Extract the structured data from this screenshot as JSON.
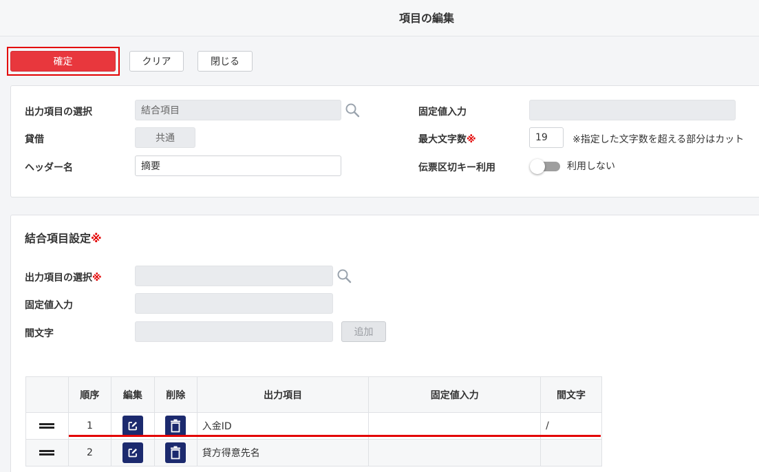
{
  "header": {
    "title": "項目の編集"
  },
  "toolbar": {
    "confirm_label": "確定",
    "clear_label": "クリア",
    "close_label": "閉じる"
  },
  "form": {
    "output_item_label": "出力項目の選択",
    "output_item_value": "結合項目",
    "debit_credit_label": "貸借",
    "debit_credit_value": "共通",
    "header_name_label": "ヘッダー名",
    "header_name_value": "摘要",
    "fixed_value_label": "固定値入力",
    "fixed_value_value": "",
    "max_chars_label": "最大文字数",
    "max_chars_required": "※",
    "max_chars_value": "19",
    "max_chars_note": "※指定した文字数を超える部分はカット",
    "voucher_split_label": "伝票区切キー利用",
    "voucher_split_toggle_label": "利用しない",
    "voucher_split_enabled": false
  },
  "combine": {
    "section_title": "結合項目設定",
    "section_required": "※",
    "output_item_label": "出力項目の選択",
    "output_item_required": "※",
    "output_item_value": "",
    "fixed_value_label": "固定値入力",
    "fixed_value_value": "",
    "separator_label": "間文字",
    "separator_value": "",
    "add_label": "追加"
  },
  "table": {
    "headers": {
      "order": "順序",
      "edit": "編集",
      "delete": "削除",
      "item": "出力項目",
      "fixed": "固定値入力",
      "separator": "間文字"
    },
    "rows": [
      {
        "order": "1",
        "item": "入金ID",
        "fixed": "",
        "separator": "/"
      },
      {
        "order": "2",
        "item": "貸方得意先名",
        "fixed": "",
        "separator": ""
      }
    ]
  },
  "colors": {
    "confirm": "#e8373d",
    "required": "#e30000",
    "icon_button": "#1c2a6e"
  }
}
